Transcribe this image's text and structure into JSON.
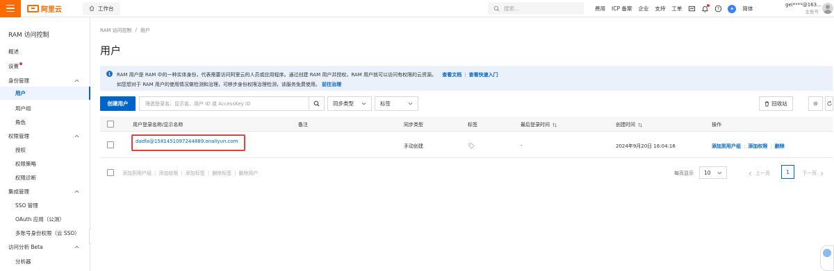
{
  "topbar": {
    "logo_text": "阿里云",
    "workbench_label": "工作台",
    "search_placeholder": "搜索...",
    "nav_items": [
      "费用",
      "ICP 备案",
      "企业",
      "支持",
      "工单"
    ],
    "language": "简体",
    "account_name": "gei****@163...",
    "account_sub": "主账号"
  },
  "sidebar": {
    "title": "RAM 访问控制",
    "overview": "概述",
    "settings": "设置",
    "identity_group": "身份管理",
    "identity_items": [
      "用户",
      "用户组",
      "角色"
    ],
    "active_item": "用户",
    "permission_group": "权限管理",
    "permission_items": [
      "授权",
      "权限策略",
      "权限诊断"
    ],
    "integration_group": "集成管理",
    "integration_items": [
      "SSO 管理",
      "OAuth 应用（公测）",
      "多账号身份权限（云 SSO）"
    ],
    "analysis_group": "访问分析 Beta",
    "analysis_items": [
      "分析器"
    ]
  },
  "main": {
    "breadcrumb": [
      "RAM 访问控制",
      "/",
      "用户"
    ],
    "title": "用户",
    "notice": {
      "line1": "RAM 用户是 RAM 中的一种实体身份，代表需要访问阿里云的人员或应用程序。通过创建 RAM 用户并授权，RAM 用户就可以访问有权限的云资源。",
      "link_docs": "查看文档",
      "link_quickstart": "查看快速入门",
      "line2": "如您想对于 RAM 用户的使用情况做检测和治理，可移步身份权限治理检测，该服务免费使用。",
      "link_govern": "前往治理"
    },
    "toolbar": {
      "create_user": "创建用户",
      "filter_placeholder": "筛选登录名、显示名、用户 ID 或 AccessKey ID",
      "sync_type": "同步类型",
      "tag": "标签",
      "recycle_bin": "回收站"
    },
    "table": {
      "columns": [
        "用户登录名称/显示名称",
        "备注",
        "同步类型",
        "标签",
        "最后登录时间",
        "创建时间",
        "操作"
      ],
      "rows": [
        {
          "login_name": "dadfa@1581451097244889.onaliyun.com",
          "display_name": "-",
          "remark": "",
          "sync_type": "手动创建",
          "last_login": "-",
          "created": "2024年9月20日 16:04:16",
          "actions": [
            "添加到用户组",
            "添加权限",
            "删除"
          ]
        }
      ]
    },
    "bulk_actions": [
      "添加到用户组",
      "添加权限",
      "添加标签",
      "删除标签",
      "删除用户"
    ],
    "pagination": {
      "per_page_label": "每页显示",
      "per_page": "10",
      "prev": "上一页",
      "current_page": "1",
      "next": "下一页"
    }
  },
  "colors": {
    "brand": "#ff6a00",
    "primary": "#0064c8",
    "highlight_border": "#e04040",
    "notice_bg": "#eaf1fb"
  }
}
